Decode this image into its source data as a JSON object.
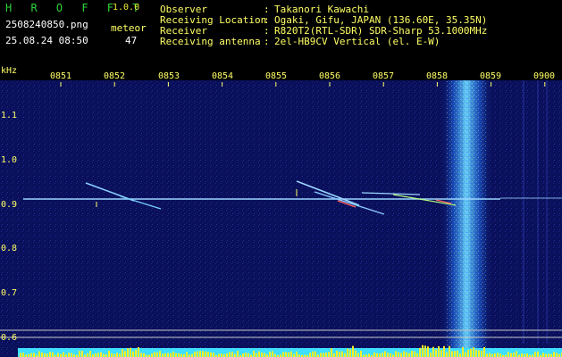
{
  "app": {
    "logo": "H R O F F T",
    "version": "1.0.0"
  },
  "file": {
    "name": "2508240850.png",
    "timestamp": "25.08.24 08:50"
  },
  "counter": {
    "label": "meteor",
    "value": "47"
  },
  "info": [
    {
      "key": "Observer",
      "sep": ":",
      "value": "Takanori Kawachi"
    },
    {
      "key": "Receiving Location",
      "sep": ":",
      "value": "Ogaki, Gifu, JAPAN (136.60E, 35.35N)"
    },
    {
      "key": "Receiver",
      "sep": ":",
      "value": "R820T2(RTL-SDR) SDR-Sharp 53.1000MHz"
    },
    {
      "key": "Receiving antenna",
      "sep": ":",
      "value": "2el-HB9CV Vertical (el. E-W)"
    }
  ],
  "axis": {
    "unit_label": "kHz",
    "time_ticks": [
      "0851",
      "0852",
      "0853",
      "0854",
      "0855",
      "0856",
      "0857",
      "0858",
      "0859",
      "0900"
    ],
    "freq_ticks": [
      "1.1",
      "1.0",
      "0.9",
      "0.8",
      "0.7",
      "0.6"
    ]
  },
  "colors": {
    "background": "#000000",
    "spectrogram_base": "#0a0f5a",
    "carrier_line": "#9ad6ff",
    "band_noise": "#3fb6ff",
    "bottom_fill": "#3fe0ff",
    "bottom_peaks": "#ffee22",
    "label_yellow": "#ffff66",
    "logo_green": "#2fd33a"
  }
}
